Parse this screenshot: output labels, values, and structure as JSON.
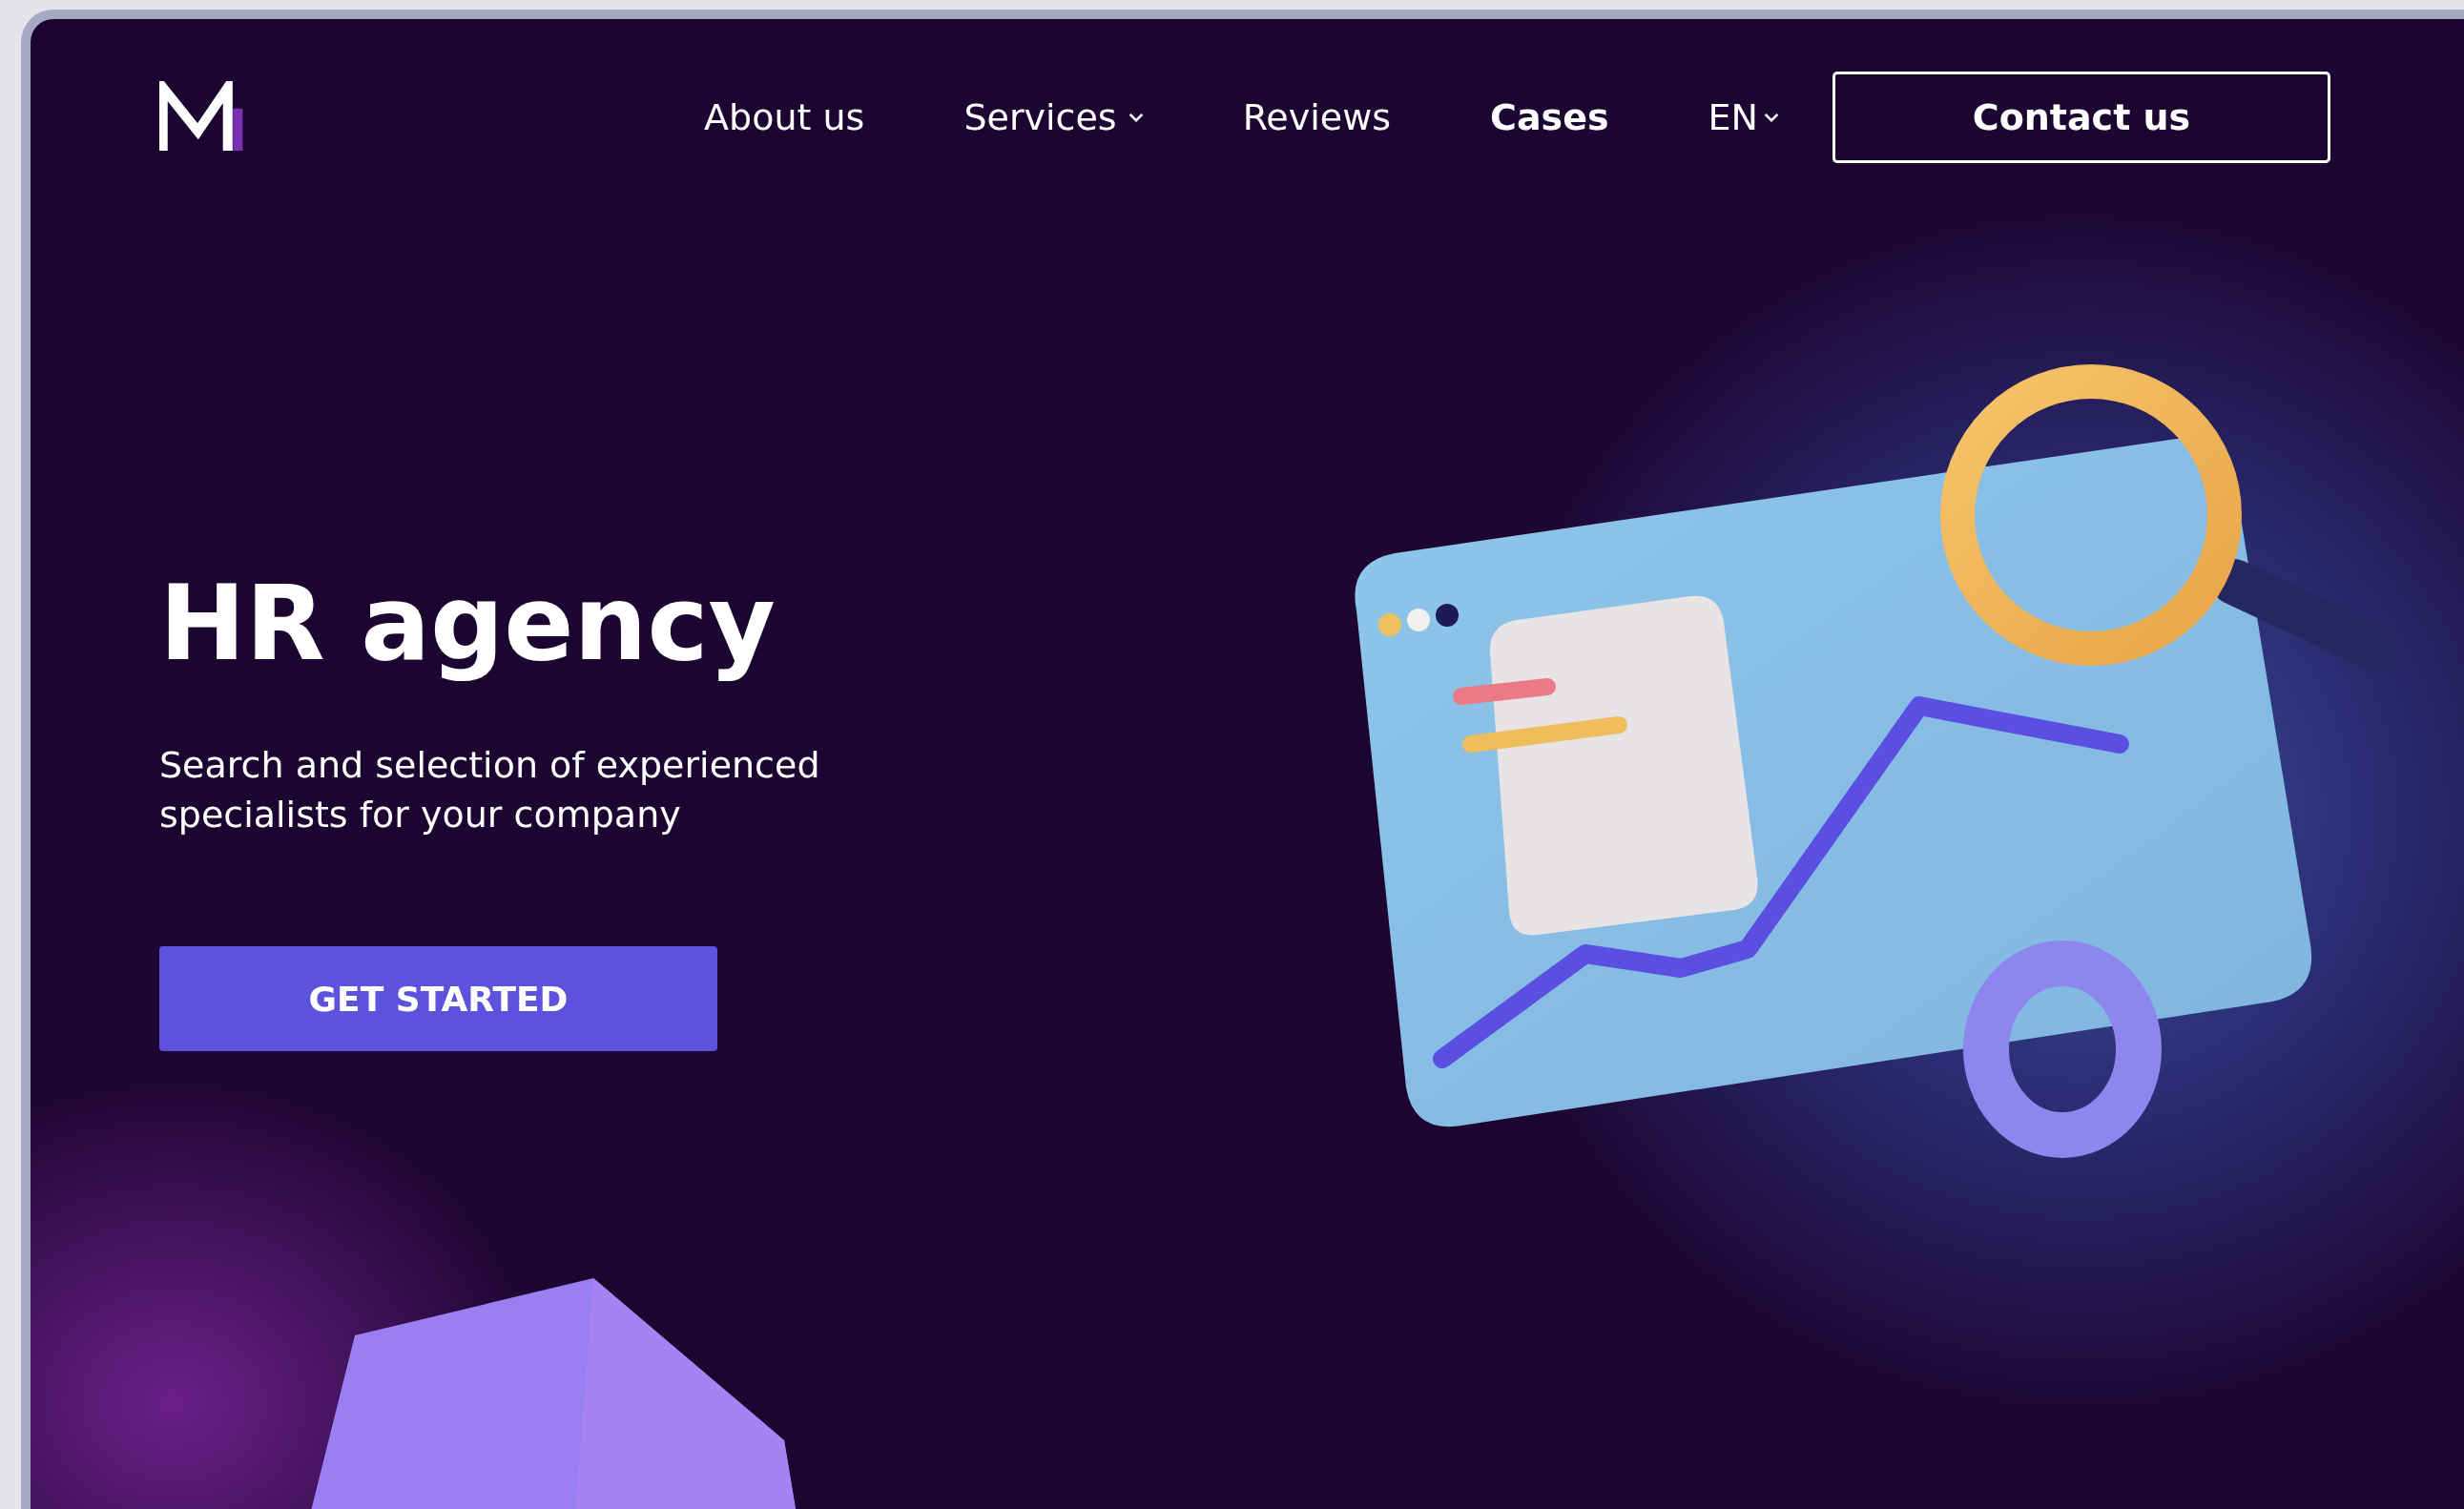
{
  "nav": {
    "items": [
      {
        "label": "About us",
        "dropdown": false,
        "selected": false
      },
      {
        "label": "Services",
        "dropdown": true,
        "selected": false
      },
      {
        "label": "Reviews",
        "dropdown": false,
        "selected": false
      },
      {
        "label": "Cases",
        "dropdown": false,
        "selected": true
      }
    ],
    "language": "EN",
    "contact_button": "Contact us"
  },
  "hero": {
    "title": "HR agency",
    "subtitle": "Search and selection of experienced specialists for your company",
    "button": "GET STARTED"
  }
}
